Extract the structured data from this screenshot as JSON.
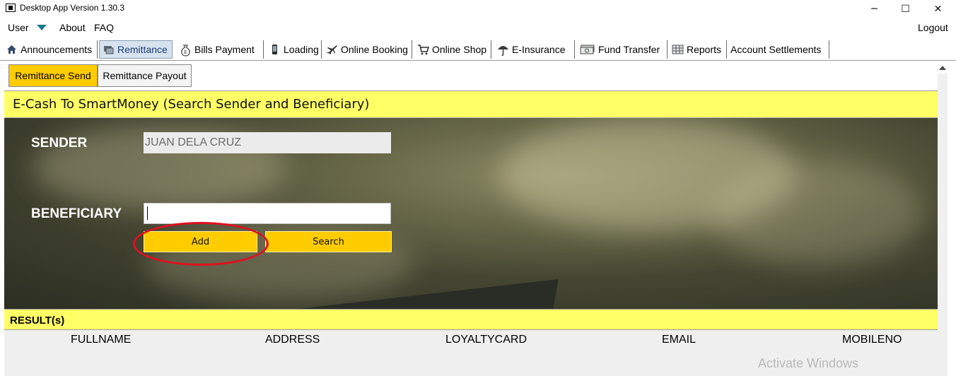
{
  "window": {
    "title": "Desktop App Version 1.30.3",
    "controls": {
      "minimize": "─",
      "maximize": "☐",
      "close": "✕"
    }
  },
  "menubar": {
    "items": [
      "User",
      "About",
      "FAQ"
    ],
    "logout": "Logout"
  },
  "tabs": [
    {
      "label": "Announcements",
      "icon": "home-icon"
    },
    {
      "label": "Remittance",
      "icon": "remittance-icon",
      "active": true
    },
    {
      "label": "Bills Payment",
      "icon": "money-bag-icon"
    },
    {
      "label": "Loading",
      "icon": "phone-icon"
    },
    {
      "label": "Online Booking",
      "icon": "airplane-icon"
    },
    {
      "label": "Online Shop",
      "icon": "cart-icon"
    },
    {
      "label": "E-Insurance",
      "icon": "umbrella-icon"
    },
    {
      "label": "Fund Transfer",
      "icon": "cash-icon"
    },
    {
      "label": "Reports",
      "icon": "report-icon"
    },
    {
      "label": "Account Settlements",
      "icon": ""
    }
  ],
  "subtabs": [
    {
      "label": "Remittance Send",
      "active": true
    },
    {
      "label": "Remittance Payout",
      "active": false
    }
  ],
  "form": {
    "title": "E-Cash To SmartMoney (Search Sender and Beneficiary)",
    "sender_label": "SENDER",
    "sender_value": "JUAN DELA CRUZ",
    "beneficiary_label": "BENEFICIARY",
    "beneficiary_value": "",
    "add_label": "Add",
    "search_label": "Search"
  },
  "results": {
    "title": "RESULT(s)",
    "columns": [
      "FULLNAME",
      "ADDRESS",
      "LOYALTYCARD",
      "EMAIL",
      "MOBILENO"
    ]
  },
  "watermark": "Activate Windows",
  "colors": {
    "accent_yellow": "#ffff66",
    "button_yellow": "#ffcc00",
    "annotation_red": "#e01020"
  }
}
